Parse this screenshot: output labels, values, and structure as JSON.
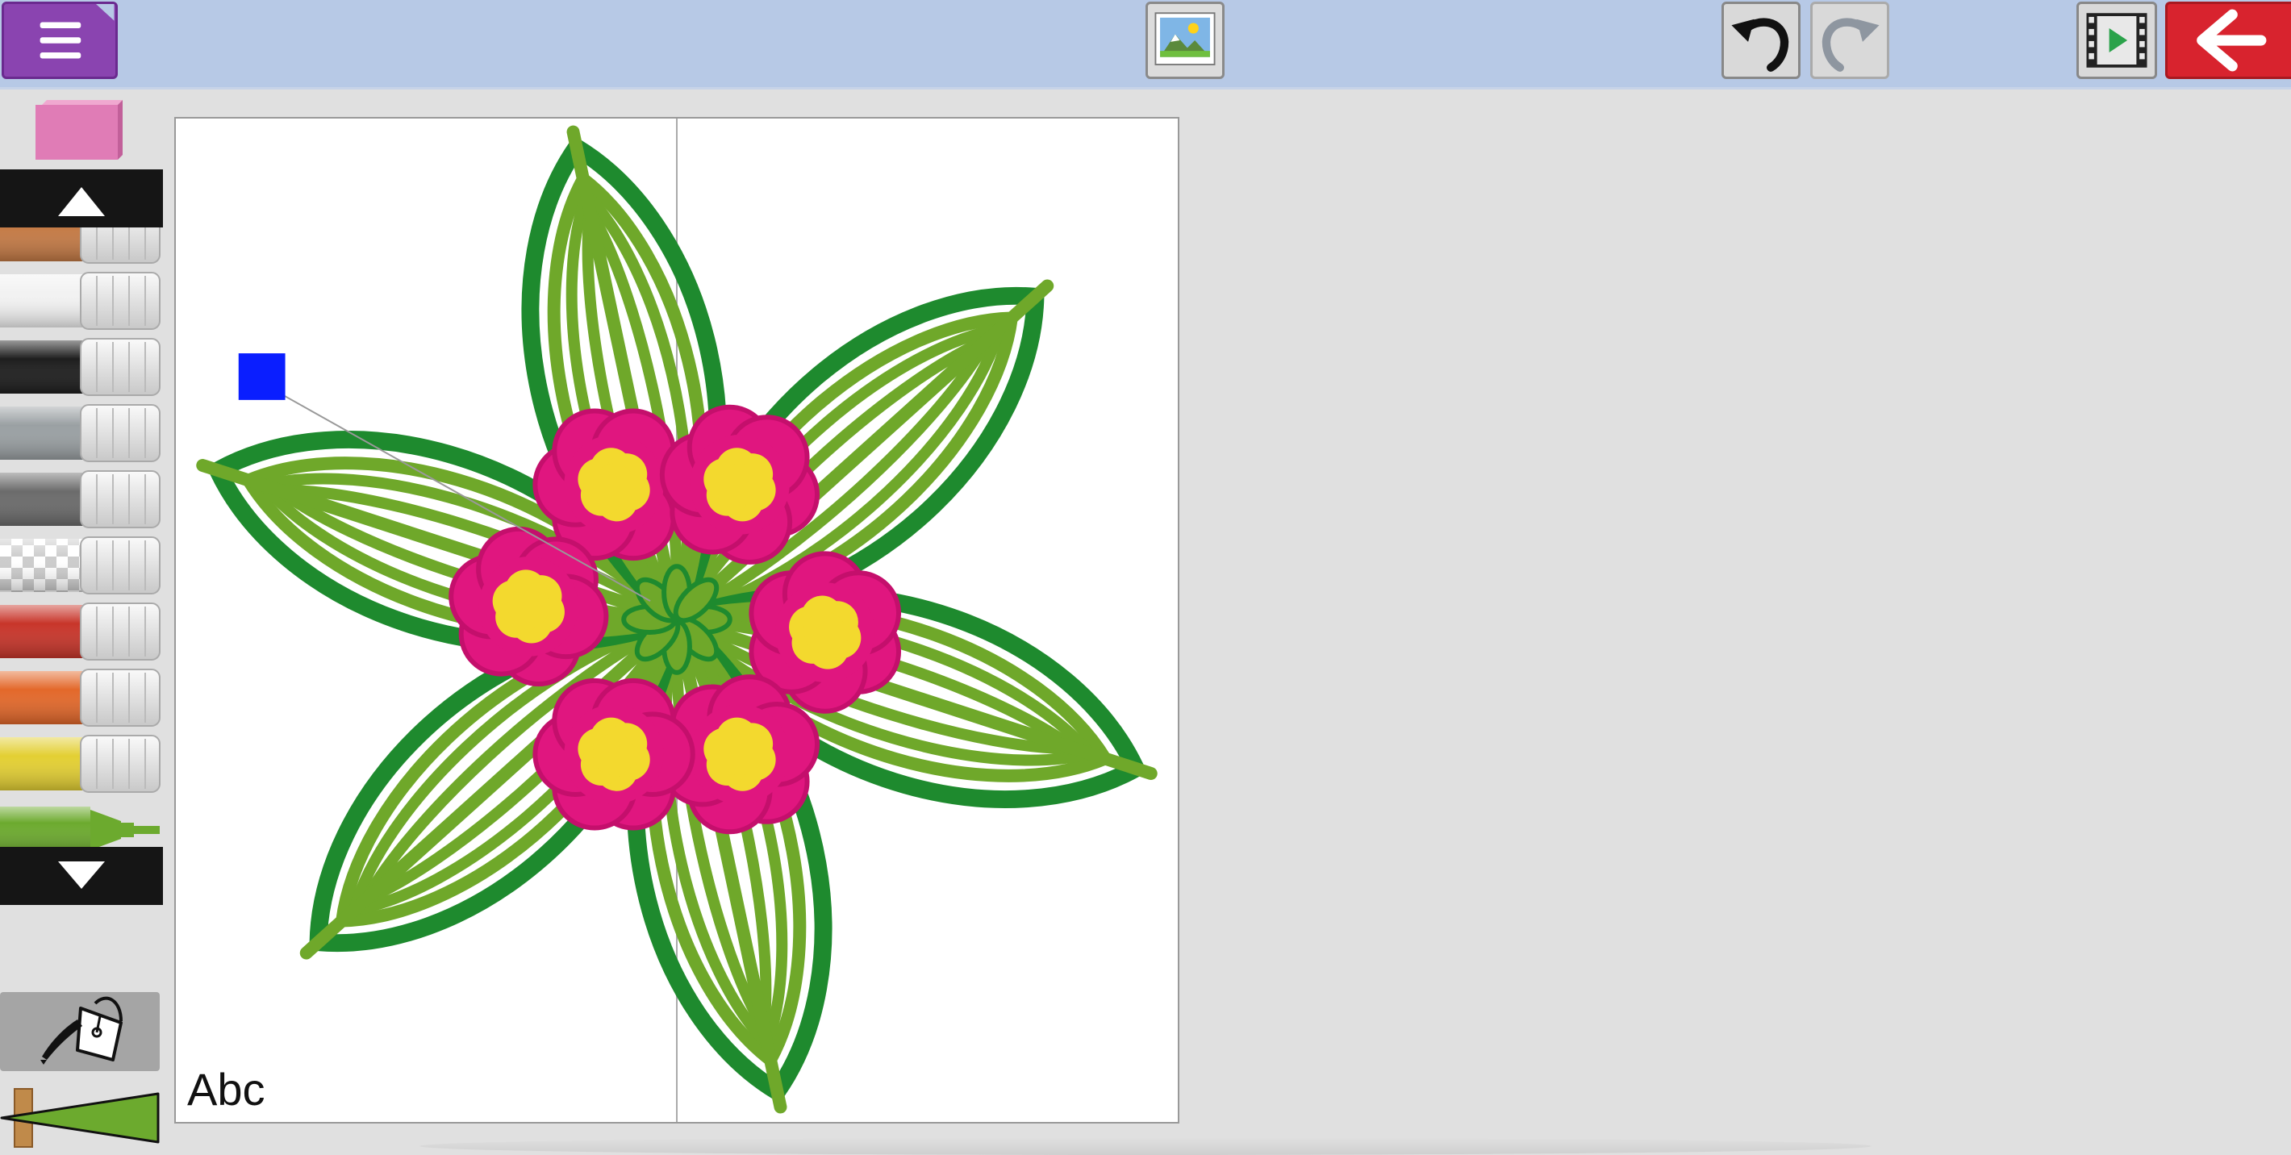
{
  "toolbar": {
    "menu": "menu-icon",
    "gallery": "image-icon",
    "undo": "undo-icon",
    "redo": "redo-icon",
    "play": "film-play-icon",
    "back": "back-arrow-icon"
  },
  "colors": {
    "topbar": "#b7c9e6",
    "menu_button": "#8a44b0",
    "back_button": "#d8232e",
    "selected_color": "#0a1eff",
    "eraser": "#e07cb6"
  },
  "palette": [
    {
      "name": "brown",
      "color": "#c47a45"
    },
    {
      "name": "white",
      "color": "#f2f2f2"
    },
    {
      "name": "black",
      "color": "#1e1e1e"
    },
    {
      "name": "light-gray",
      "color": "#9aa0a3"
    },
    {
      "name": "dark-gray",
      "color": "#6b6b6b"
    },
    {
      "name": "transparent",
      "color": "checker"
    },
    {
      "name": "red",
      "color": "#c8352a"
    },
    {
      "name": "orange",
      "color": "#e3682a"
    },
    {
      "name": "yellow",
      "color": "#e3cf33"
    },
    {
      "name": "green",
      "color": "#6caa2e"
    }
  ],
  "canvas": {
    "text_tool_label": "Abc"
  }
}
